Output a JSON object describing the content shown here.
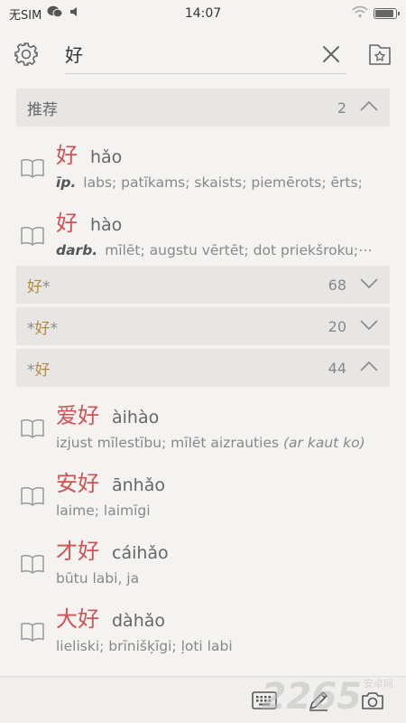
{
  "status": {
    "carrier": "无SIM",
    "time": "14:07",
    "battery_level": 0.9
  },
  "search": {
    "value": "好",
    "placeholder": ""
  },
  "groups": [
    {
      "title": "推荐",
      "count": "2",
      "expanded": true,
      "entries": [
        {
          "hanzi": "好",
          "pinyin": "hǎo",
          "pos": "īp.",
          "definition": "labs; patīkams; skaists; piemērots; ērts;"
        },
        {
          "hanzi": "好",
          "pinyin": "hào",
          "pos": "darb.",
          "definition": "mīlēt; augstu vērtēt; dot priekšroku;⋯"
        }
      ]
    },
    {
      "title_prefix": "",
      "title_hl": "好",
      "title_suffix": "*",
      "count": "68",
      "expanded": false
    },
    {
      "title_prefix": "*",
      "title_hl": "好",
      "title_suffix": "*",
      "count": "20",
      "expanded": false
    },
    {
      "title_prefix": "*",
      "title_hl": "好",
      "title_suffix": "",
      "count": "44",
      "expanded": true,
      "entries": [
        {
          "hanzi": "爱好",
          "pinyin": "àihào",
          "definition": "izjust mīlestību; mīlēt aizrauties",
          "note": "(ar kaut ko)"
        },
        {
          "hanzi": "安好",
          "pinyin": "ānhǎo",
          "definition": "laime; laimīgi"
        },
        {
          "hanzi": "才好",
          "pinyin": "cáihǎo",
          "definition": "būtu labi, ja"
        },
        {
          "hanzi": "大好",
          "pinyin": "dàhǎo",
          "definition": "lieliski; brīnišķīgi; ļoti labi"
        }
      ]
    }
  ],
  "watermark": {
    "text": "2265",
    "suffix": "安卓网"
  },
  "icons": [
    "wechat-icon",
    "mute-icon",
    "wifi-icon",
    "battery-icon",
    "settings-gear-icon",
    "clear-x-icon",
    "favorites-folder-star-icon",
    "book-icon",
    "chevron-up-icon",
    "chevron-down-icon",
    "keyboard-icon",
    "pencil-icon",
    "camera-icon"
  ],
  "colors": {
    "hanzi": "#d05252",
    "highlight": "#b68a3e",
    "background": "#f4f3f1",
    "header": "#e7e6e4"
  }
}
